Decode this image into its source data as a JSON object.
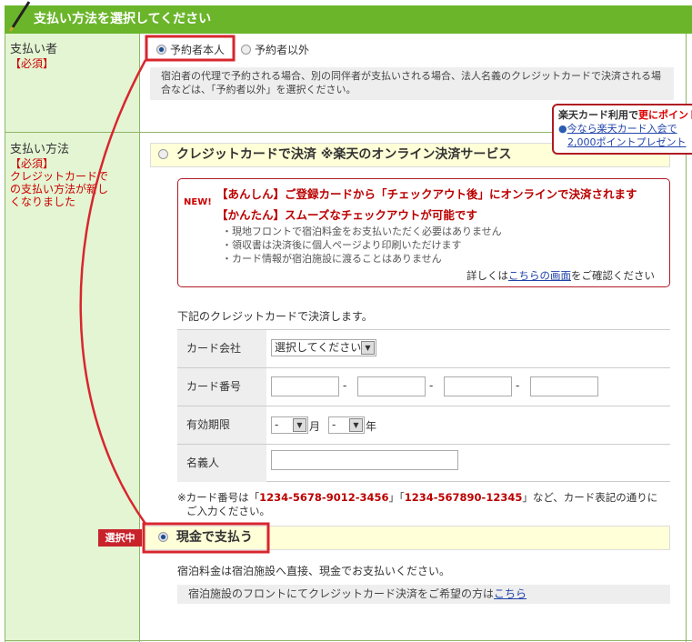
{
  "header": {
    "title": "支払い方法を選択してください"
  },
  "payer": {
    "label": "支払い者",
    "required": "【必須】",
    "options": [
      {
        "label": "予約者本人",
        "selected": true
      },
      {
        "label": "予約者以外",
        "selected": false
      }
    ],
    "note": "宿泊者の代理で予約される場合、別の同伴者が支払いされる場合、法人名義のクレジットカードで決済される場合などは、「予約者以外」を選択ください。"
  },
  "promo": {
    "title_a": "楽天カード利用で",
    "title_b": "更にポイント",
    "link_line1": "今なら楽天カード入会で",
    "link_line2": "2,000ポイントプレゼント"
  },
  "method": {
    "label": "支払い方法",
    "required": "【必須】",
    "notice": "クレジットカードでの支払い方法が新しくなりました",
    "credit": {
      "label": "クレジットカードで決済 ※楽天のオンライン決済サービス",
      "selected": false,
      "new_badge": "NEW!",
      "line1_tag": "【あんしん】",
      "line1": "ご登録カードから「チェックアウト後」にオンラインで決済されます",
      "line2_tag": "【かんたん】",
      "line2": "スムーズなチェックアウトが可能です",
      "bullets": [
        "・現地フロントで宿泊料金をお支払いただく必要はありません",
        "・領収書は決済後に個人ページより印刷いただけます",
        "・カード情報が宿泊施設に渡ることはありません"
      ],
      "details_pre": "詳しくは",
      "details_link": "こちらの画面",
      "details_post": "をご確認ください",
      "intro": "下記のクレジットカードで決済します。",
      "fields": {
        "company_label": "カード会社",
        "company_value": "選択してください",
        "number_label": "カード番号",
        "sep": "-",
        "expiry_label": "有効期限",
        "month_value": "-",
        "month_unit": "月",
        "year_value": "-",
        "year_unit": "年",
        "holder_label": "名義人"
      },
      "example_pre": "※カード番号は「",
      "example1": "1234-5678-9012-3456",
      "example_mid": "」「",
      "example2": "1234-567890-12345",
      "example_post": "」など、カード表記の通りに",
      "example_line2": "ご入力ください。"
    },
    "cash": {
      "badge": "選択中",
      "label": "現金で支払う",
      "selected": true,
      "note": "宿泊料金は宿泊施設へ直接、現金でお支払いください。",
      "front_note": "宿泊施設のフロントにてクレジットカード決済をご希望の方は",
      "front_link": "こちら"
    }
  },
  "colors": {
    "header": "#6bb52b",
    "left": "#e3f5d3",
    "annotation": "#d8262e"
  }
}
